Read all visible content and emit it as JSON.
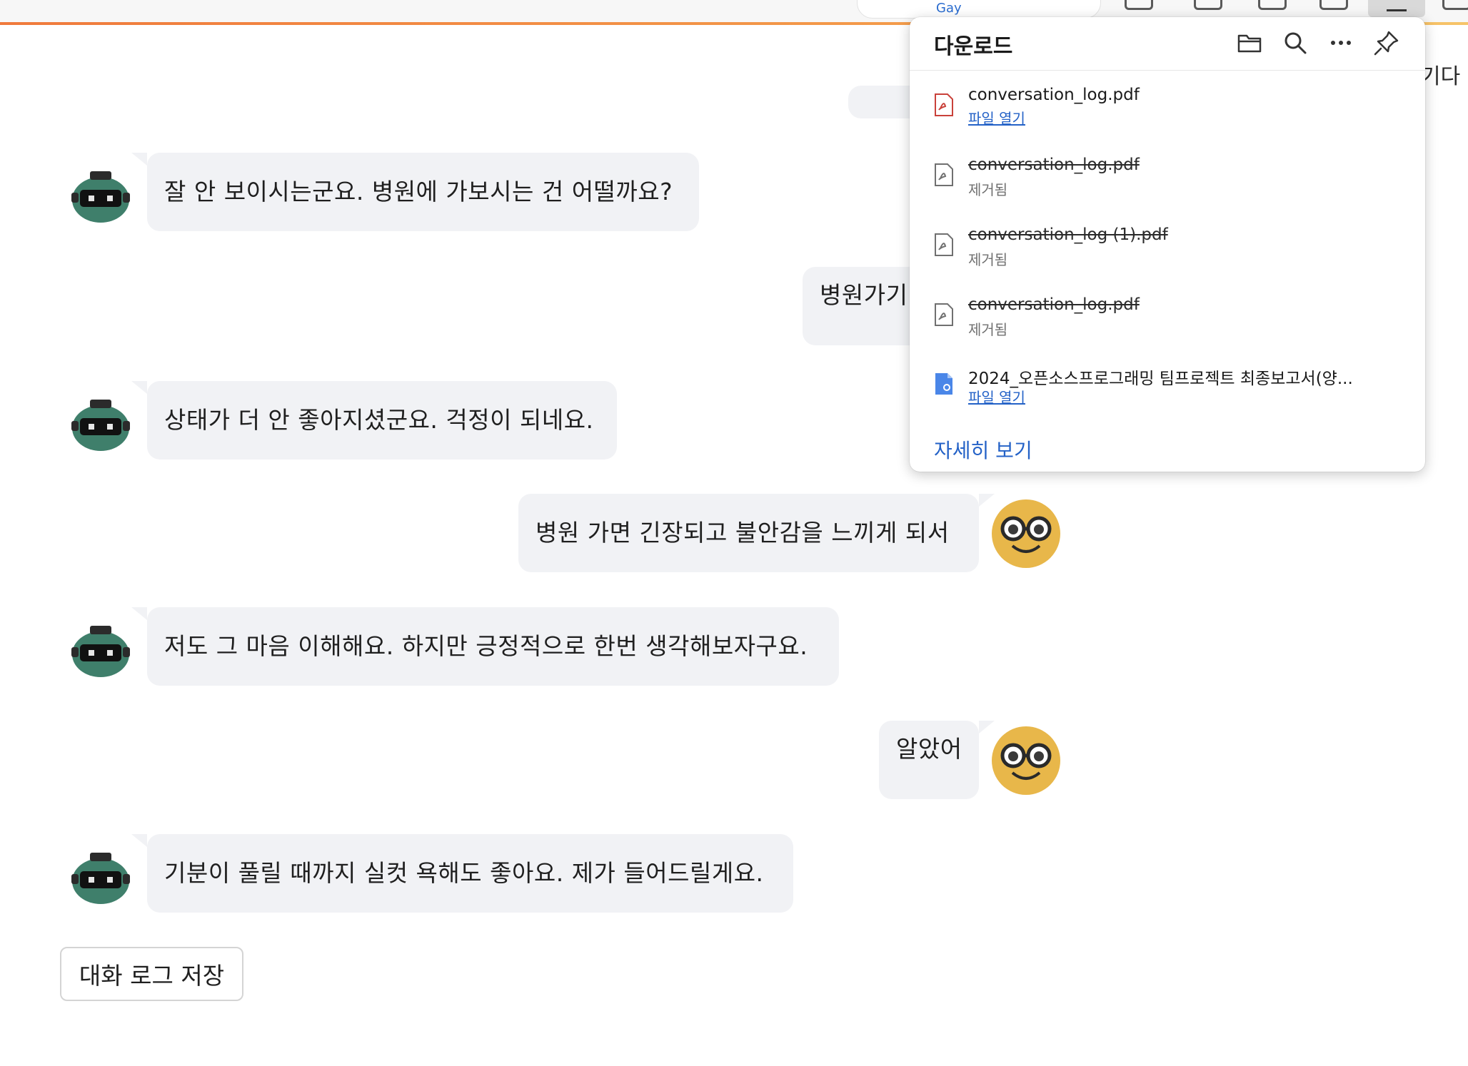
{
  "browser": {
    "address_fragment": "Gay"
  },
  "chat": {
    "messages": [
      {
        "role": "bot",
        "text": "잘 안 보이시는군요. 병원에 가보시는 건 어떨까요?"
      },
      {
        "role": "user",
        "text": "병원가기"
      },
      {
        "role": "bot",
        "text": "상태가 더 안 좋아지셨군요. 걱정이 되네요."
      },
      {
        "role": "user",
        "text": "병원 가면 긴장되고 불안감을 느끼게 되서"
      },
      {
        "role": "bot",
        "text": "저도 그 마음 이해해요. 하지만 긍정적으로 한번 생각해보자구요."
      },
      {
        "role": "user",
        "text": "알았어"
      },
      {
        "role": "bot",
        "text": "기분이 풀릴 때까지 실컷 욕해도 좋아요. 제가 들어드릴게요."
      }
    ],
    "save_button": "대화 로그 저장",
    "side_text": "기다"
  },
  "downloads": {
    "title": "다운로드",
    "items": [
      {
        "name": "conversation_log.pdf",
        "status": "파일 열기",
        "removed": false,
        "icon": "pdf-icon"
      },
      {
        "name": "conversation_log.pdf",
        "status": "제거됨",
        "removed": true,
        "icon": "pdf-icon"
      },
      {
        "name": "conversation_log (1).pdf",
        "status": "제거됨",
        "removed": true,
        "icon": "pdf-icon"
      },
      {
        "name": "conversation_log.pdf",
        "status": "제거됨",
        "removed": true,
        "icon": "pdf-icon"
      },
      {
        "name": "2024_오픈소스프로그래밍 팀프로젝트 최종보고서(양...",
        "status": "파일 열기",
        "removed": false,
        "icon": "doc-icon"
      }
    ],
    "more_link": "자세히 보기"
  },
  "colors": {
    "bubble": "#f1f2f5",
    "link": "#2462c7",
    "user_avatar": "#e8b74a",
    "bot_avatar": "#3f7f6b"
  }
}
